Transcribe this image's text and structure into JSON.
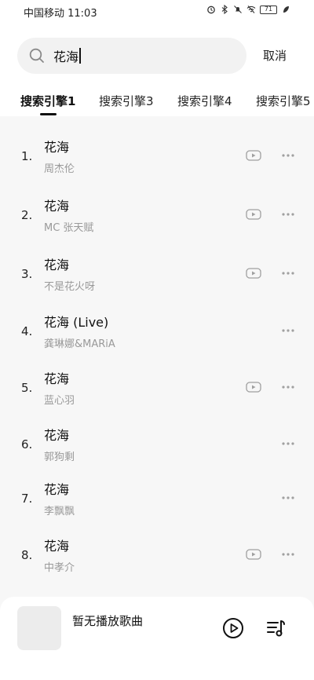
{
  "status_bar": {
    "carrier_time": "中国移动 11:03",
    "battery": "71"
  },
  "search": {
    "query": "花海",
    "cancel_label": "取消"
  },
  "tabs": [
    {
      "label": "搜索引擎1",
      "active": true
    },
    {
      "label": "搜索引擎3",
      "active": false
    },
    {
      "label": "搜索引擎4",
      "active": false
    },
    {
      "label": "搜索引擎5",
      "active": false
    }
  ],
  "songs": [
    {
      "index": "1.",
      "title": "花海",
      "artist": "周杰伦",
      "has_mv": true
    },
    {
      "index": "2.",
      "title": "花海",
      "artist": "MC 张天赋",
      "has_mv": true
    },
    {
      "index": "3.",
      "title": "花海",
      "artist": "不是花火呀",
      "has_mv": true
    },
    {
      "index": "4.",
      "title": "花海 (Live)",
      "artist": "龚琳娜&MARiA",
      "has_mv": false
    },
    {
      "index": "5.",
      "title": "花海",
      "artist": "蓝心羽",
      "has_mv": true
    },
    {
      "index": "6.",
      "title": "花海",
      "artist": "郭狗剩",
      "has_mv": false
    },
    {
      "index": "7.",
      "title": "花海",
      "artist": "李飘飘",
      "has_mv": false
    },
    {
      "index": "8.",
      "title": "花海",
      "artist": "中孝介",
      "has_mv": true
    }
  ],
  "player": {
    "now_playing": "暂无播放歌曲"
  },
  "colors": {
    "accent": "#111111",
    "secondary_text": "#999999",
    "icon_gray": "#a0a0a0"
  }
}
